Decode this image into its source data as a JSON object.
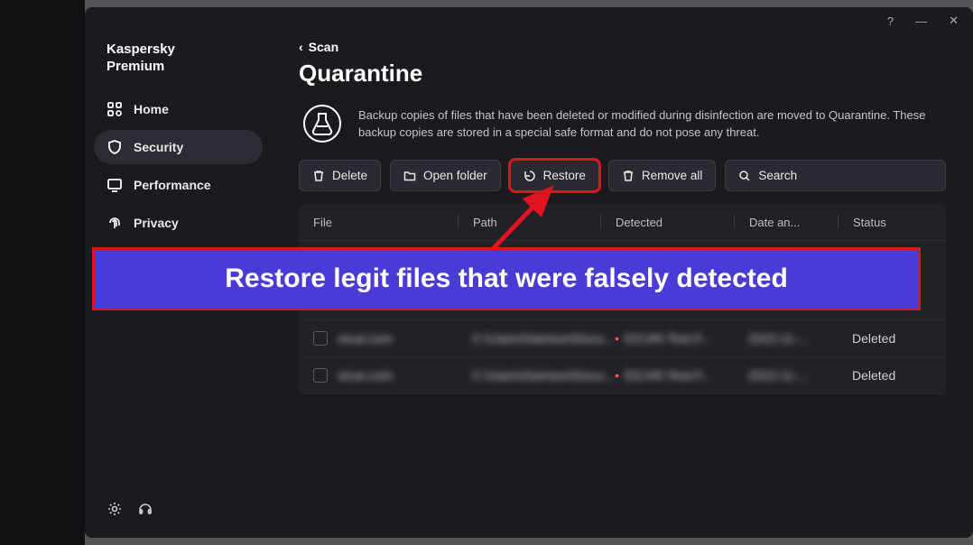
{
  "brand_line1": "Kaspersky",
  "brand_line2": "Premium",
  "nav": {
    "home": "Home",
    "security": "Security",
    "performance": "Performance",
    "privacy": "Privacy"
  },
  "breadcrumb": "Scan",
  "page_title": "Quarantine",
  "info_text": "Backup copies of files that have been deleted or modified during disinfection are moved to Quarantine. These backup copies are stored in a special safe format and do not pose any threat.",
  "toolbar": {
    "delete": "Delete",
    "open_folder": "Open folder",
    "restore": "Restore",
    "remove_all": "Remove all",
    "search": "Search"
  },
  "columns": {
    "file": "File",
    "path": "Path",
    "detected": "Detected",
    "date": "Date an...",
    "status": "Status"
  },
  "rows": [
    {
      "file": "eicar.com",
      "path": "C:\\Users\\Samson\\Docu...",
      "detected": "EICAR-Test-F...",
      "date": "2022-11-...",
      "status": "Deleted"
    },
    {
      "file": "eicar.com",
      "path": "C:\\Users\\Samson\\Docu...",
      "detected": "EICAR-Test-F...",
      "date": "2022-11-...",
      "status": "Deleted"
    }
  ],
  "callout": "Restore legit files that were falsely detected"
}
